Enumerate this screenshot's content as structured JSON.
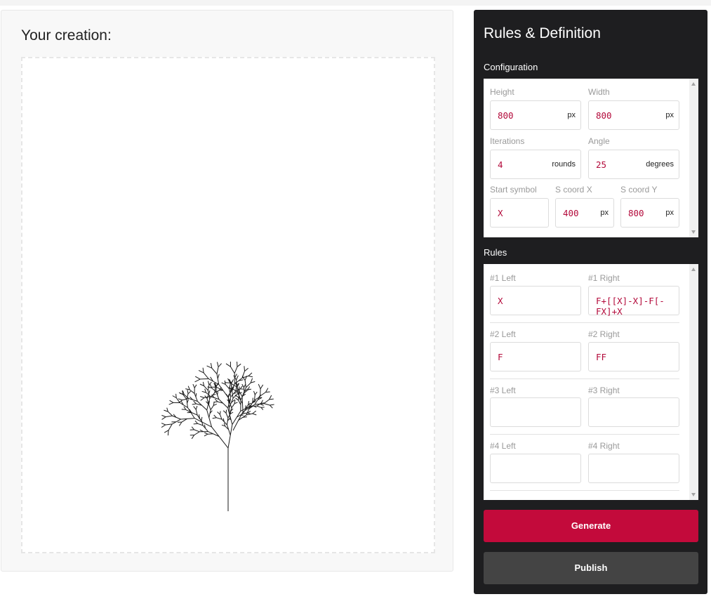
{
  "creation": {
    "title": "Your creation:"
  },
  "panel": {
    "heading": "Rules & Definition",
    "configuration_label": "Configuration",
    "rules_label": "Rules"
  },
  "config": {
    "height": {
      "label": "Height",
      "value": "800",
      "unit": "px"
    },
    "width": {
      "label": "Width",
      "value": "800",
      "unit": "px"
    },
    "iterations": {
      "label": "Iterations",
      "value": "4",
      "unit": "rounds"
    },
    "angle": {
      "label": "Angle",
      "value": "25",
      "unit": "degrees"
    },
    "start_symbol": {
      "label": "Start symbol",
      "value": "X"
    },
    "s_coord_x": {
      "label": "S coord X",
      "value": "400",
      "unit": "px"
    },
    "s_coord_y": {
      "label": "S coord Y",
      "value": "800",
      "unit": "px"
    }
  },
  "rules": [
    {
      "left_label": "#1 Left",
      "left_value": "X",
      "right_label": "#1 Right",
      "right_value": "F+[[X]-X]-F[-FX]+X"
    },
    {
      "left_label": "#2 Left",
      "left_value": "F",
      "right_label": "#2 Right",
      "right_value": "FF"
    },
    {
      "left_label": "#3 Left",
      "left_value": "",
      "right_label": "#3 Right",
      "right_value": ""
    },
    {
      "left_label": "#4 Left",
      "left_value": "",
      "right_label": "#4 Right",
      "right_value": ""
    }
  ],
  "buttons": {
    "generate": "Generate",
    "publish": "Publish"
  },
  "colors": {
    "accent": "#c30a3b",
    "panel_bg": "#1e1e20",
    "value_text": "#b3093a",
    "publish_bg": "#444444"
  }
}
